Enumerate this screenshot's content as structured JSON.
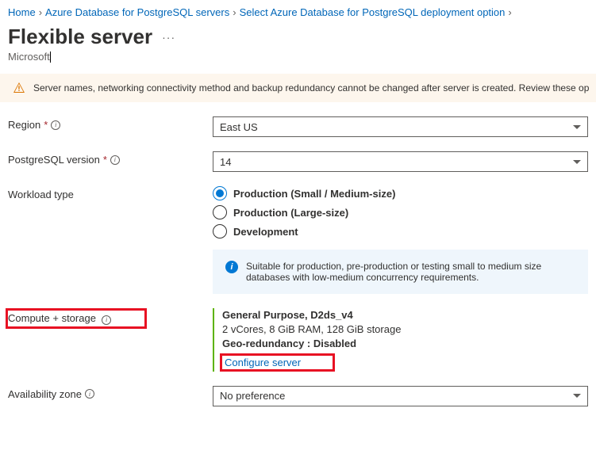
{
  "breadcrumb": {
    "home": "Home",
    "level1": "Azure Database for PostgreSQL servers",
    "level2": "Select Azure Database for PostgreSQL deployment option"
  },
  "page": {
    "title": "Flexible server",
    "subtitle": "Microsoft"
  },
  "banner": {
    "text": "Server names, networking connectivity method and backup redundancy cannot be changed after server is created. Review these op"
  },
  "form": {
    "region": {
      "label": "Region",
      "value": "East US"
    },
    "version": {
      "label": "PostgreSQL version",
      "value": "14"
    },
    "workload": {
      "label": "Workload type",
      "options": [
        {
          "label": "Production (Small / Medium-size)",
          "checked": true
        },
        {
          "label": "Production (Large-size)",
          "checked": false
        },
        {
          "label": "Development",
          "checked": false
        }
      ],
      "info": "Suitable for production, pre-production or testing small to medium size databases with low-medium concurrency requirements."
    },
    "compute": {
      "label": "Compute + storage",
      "sku": "General Purpose, D2ds_v4",
      "spec": "2 vCores, 8 GiB RAM, 128 GiB storage",
      "geo": "Geo-redundancy : Disabled",
      "configure": "Configure server"
    },
    "zone": {
      "label": "Availability zone",
      "value": "No preference"
    }
  }
}
